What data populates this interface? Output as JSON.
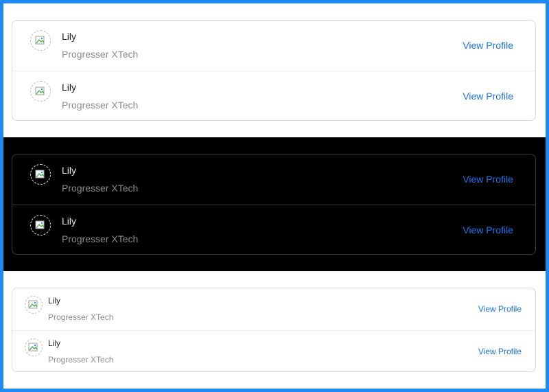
{
  "colors": {
    "frame": "#1e8af5",
    "link": "#1a73e8",
    "dark_bg": "#000000",
    "light_bg": "#ffffff",
    "secondary_text": "#8c8c8c"
  },
  "icons": {
    "avatar": "broken-image-icon"
  },
  "lists": [
    {
      "theme": "light",
      "size": "large",
      "items": [
        {
          "name": "Lily",
          "description": "Progresser XTech",
          "action": "View Profile"
        },
        {
          "name": "Lily",
          "description": "Progresser XTech",
          "action": "View Profile"
        }
      ]
    },
    {
      "theme": "dark",
      "size": "large",
      "items": [
        {
          "name": "Lily",
          "description": "Progresser XTech",
          "action": "View Profile"
        },
        {
          "name": "Lily",
          "description": "Progresser XTech",
          "action": "View Profile"
        }
      ]
    },
    {
      "theme": "light",
      "size": "small",
      "items": [
        {
          "name": "Lily",
          "description": "Progresser XTech",
          "action": "View Profile"
        },
        {
          "name": "Lily",
          "description": "Progresser XTech",
          "action": "View Profile"
        }
      ]
    }
  ]
}
